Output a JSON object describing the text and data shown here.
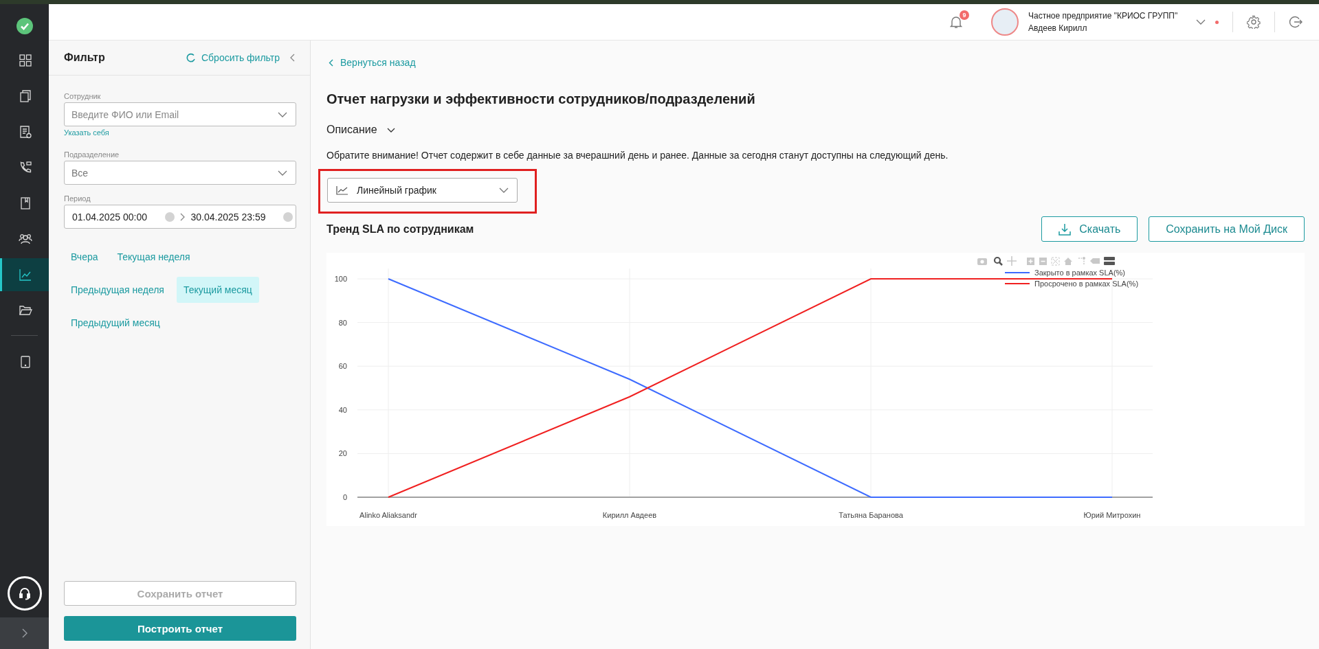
{
  "sidebar": {
    "nav_items": [
      {
        "selected": false
      },
      {
        "selected": false
      },
      {
        "selected": false
      },
      {
        "selected": false
      },
      {
        "selected": false
      },
      {
        "selected": false
      },
      {
        "selected": true
      },
      {
        "selected": false
      },
      {
        "selected": false
      }
    ]
  },
  "header": {
    "notifications_count": "9",
    "organization": "Частное предприятие \"КРИОС ГРУПП\"",
    "user": "Авдеев Кирилл"
  },
  "filter": {
    "title": "Фильтр",
    "reset": "Сбросить фильтр",
    "employee": {
      "label": "Сотрудник",
      "placeholder": "Введите ФИО или Email",
      "link": "Указать себя"
    },
    "department": {
      "label": "Подразделение",
      "value": "Все"
    },
    "period": {
      "label": "Период",
      "from": "01.04.2025 00:00",
      "to": "30.04.2025 23:59"
    },
    "presets": [
      [
        {
          "label": "Вчера",
          "selected": false
        },
        {
          "label": "Текущая неделя",
          "selected": false
        }
      ],
      [
        {
          "label": "Предыдущая неделя",
          "selected": false
        },
        {
          "label": "Текущий месяц",
          "selected": true
        }
      ],
      [
        {
          "label": "Предыдущий месяц",
          "selected": false
        }
      ]
    ],
    "save_button": {
      "label": "Сохранить отчет",
      "disabled": true
    },
    "build_button": {
      "label": "Построить отчет"
    }
  },
  "main": {
    "back": "Вернуться назад",
    "title": "Отчет нагрузки и эффективности сотрудников/подразделений",
    "description": "Описание",
    "notice": "Обратите внимание! Отчет содержит в себе данные за вчерашний день и ранее. Данные за сегодня станут доступны на следующий день.",
    "chart_type": "Линейный график",
    "chart_title": "Тренд SLA по сотрудникам",
    "download": "Скачать",
    "save_to_disk": "Сохранить на Мой Диск",
    "chart_data": {
      "type": "line",
      "grid": true,
      "legend": true,
      "categories": [
        "Alinko Aliaksandr",
        "Кирилл Авдеев",
        "Татьяна Баранова",
        "Юрий Митрохин"
      ],
      "yticks": [
        0,
        20,
        40,
        60,
        80,
        100
      ],
      "ylim": [
        0,
        100
      ],
      "series": [
        {
          "name": "Закрыто в рамках SLA(%)",
          "color": "#3d6bff",
          "values": [
            100,
            54,
            0,
            0
          ]
        },
        {
          "name": "Просрочено в рамках SLA(%)",
          "color": "#f02020",
          "values": [
            0,
            46,
            100,
            100
          ]
        }
      ]
    }
  }
}
